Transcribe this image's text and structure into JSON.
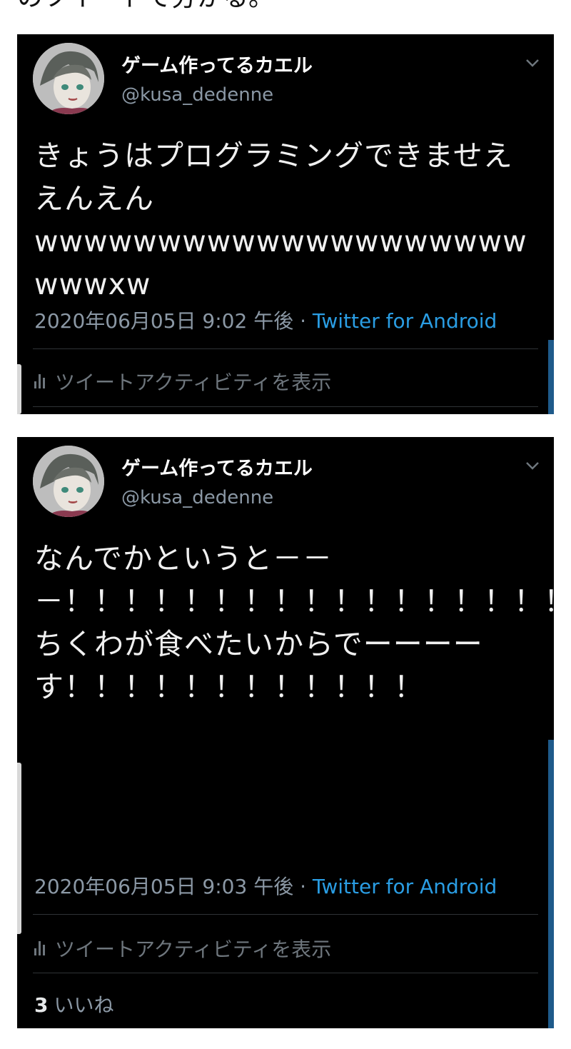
{
  "caption": "のツイートで分かる。",
  "tweets": [
    {
      "display_name": "ゲーム作ってるカエル",
      "handle": "@kusa_dedenne",
      "text": "きょうはプログラミングできませええんえん\nwwwwwwwwwwwwwwwwwwwwwwwxw",
      "timestamp": "2020年06月05日 9:02 午後 · ",
      "source": "Twitter for Android",
      "activity_label": "ツイートアクティビティを表示"
    },
    {
      "display_name": "ゲーム作ってるカエル",
      "handle": "@kusa_dedenne",
      "text": "なんでかというと－－－！！！！！！！！！！！！！！！！！！！！！！！！！！！！！！！！！！！！！！！！！！！！！！！！！ちくわが食べたいからでーーーーす！！！！！！！！！！！！",
      "timestamp": "2020年06月05日 9:03 午後 · ",
      "source": "Twitter for Android",
      "activity_label": "ツイートアクティビティを表示",
      "likes_count": "3",
      "likes_label": "いいね"
    }
  ],
  "icons": {
    "avatar": "avatar",
    "menu": "chevron-down-icon",
    "activity": "bar-chart-icon"
  },
  "colors": {
    "background": "#000000",
    "link": "#2a9de3",
    "muted": "#8b98a5"
  }
}
